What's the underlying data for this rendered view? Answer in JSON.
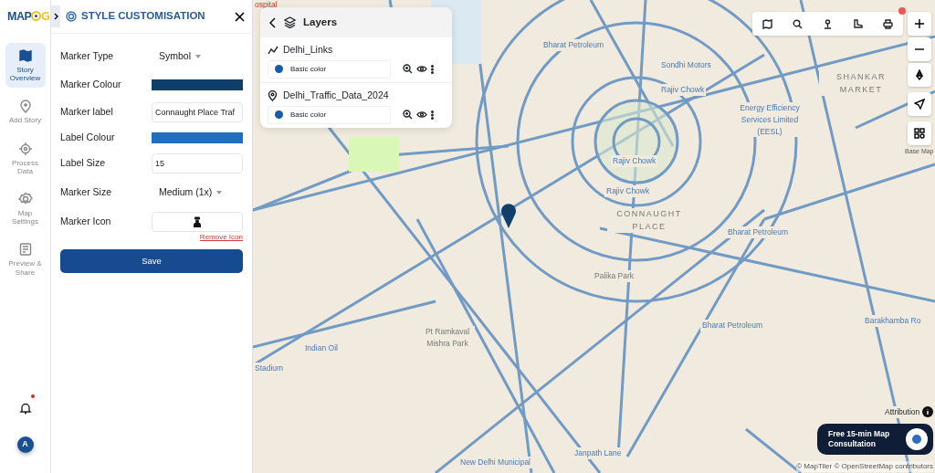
{
  "logo": {
    "text": "MAP",
    "accent": "G"
  },
  "rail": {
    "items": [
      {
        "kind": "map",
        "label": "Story Overview",
        "selected": true
      },
      {
        "kind": "pin",
        "label": "Add Story",
        "selected": false
      },
      {
        "kind": "gear",
        "label": "Process Data",
        "selected": false
      },
      {
        "kind": "cog",
        "label": "Map Settings",
        "selected": false
      },
      {
        "kind": "doc",
        "label": "Preview & Share",
        "selected": false
      }
    ],
    "notification": {
      "unread": true
    },
    "avatar": "A"
  },
  "panel": {
    "title": "STYLE CUSTOMISATION",
    "fields": [
      {
        "kind": "select",
        "label": "Marker Type",
        "value": "Symbol"
      },
      {
        "kind": "color",
        "label": "Marker Colour",
        "color": "#0f3e6a"
      },
      {
        "kind": "text",
        "label": "Marker label",
        "value": "Connaught Place Traf"
      },
      {
        "kind": "color",
        "label": "Label Colour",
        "color": "#1e6fc0"
      },
      {
        "kind": "text",
        "label": "Label Size",
        "value": "15"
      },
      {
        "kind": "select",
        "label": "Marker Size",
        "value": "Medium (1x)"
      },
      {
        "kind": "icon",
        "label": "Marker Icon",
        "action": "Remove Icon"
      }
    ],
    "save": "Save"
  },
  "layers": {
    "title": "Layers",
    "items": [
      {
        "kind": "line",
        "name": "Delhi_Links",
        "style": "Basic color",
        "color": "#1a5aa6"
      },
      {
        "kind": "point",
        "name": "Delhi_Traffic_Data_2024",
        "style": "Basic color",
        "color": "#1a5aa6"
      }
    ]
  },
  "map_labels": [
    "ospital",
    "Bharat Petroleum",
    "Sondhi Motors",
    "Rajiv Chowk",
    "SHANKAR MARKET",
    "Energy Efficiency Services Limited (EESL)",
    "Rajiv Chowk",
    "Rajiv Chowk",
    "CONNAUGHT PLACE",
    "Bharat Petroleum",
    "Palika Park",
    "Pt Ramkaval Mishra Park",
    "Indian Oil",
    "Stadium",
    "Bharat Petroleum",
    "Barakhamba Ro",
    "Janpath Lane",
    "New Delhi Municipal"
  ],
  "basemap_label": "Base Map",
  "attribution": "Attribution",
  "consultation": "Free 15-min Map Consultation",
  "credits": "© MapTiler © OpenStreetMap contributors"
}
